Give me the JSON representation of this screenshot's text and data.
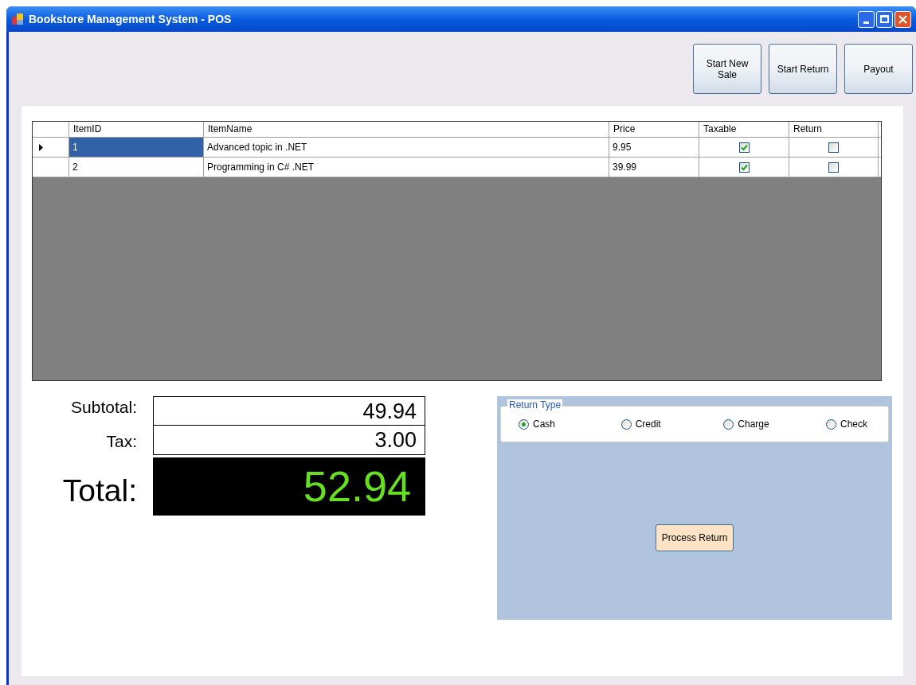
{
  "window": {
    "title": "Bookstore Management System - POS"
  },
  "toolbar_buttons": [
    "Start New\nSale",
    "Start Return",
    "Payout"
  ],
  "table": {
    "columns": [
      "ItemID",
      "ItemName",
      "Price",
      "Taxable",
      "Return"
    ],
    "rows": [
      {
        "selected": true,
        "item_id": "1",
        "item_name": "Advanced topic in .NET",
        "price": "9.95",
        "taxable": true,
        "return": false
      },
      {
        "selected": false,
        "item_id": "2",
        "item_name": "Programming in C# .NET",
        "price": "39.99",
        "taxable": true,
        "return": false
      }
    ]
  },
  "totals": {
    "subtotal_label": "Subtotal:",
    "subtotal": "49.94",
    "tax_label": "Tax:",
    "tax": "3.00",
    "total_label": "Total:",
    "total": "52.94"
  },
  "return_panel": {
    "group_title": "Return Type",
    "options": [
      {
        "label": "Cash",
        "selected": true
      },
      {
        "label": "Credit",
        "selected": false
      },
      {
        "label": "Charge",
        "selected": false
      },
      {
        "label": "Check",
        "selected": false
      }
    ],
    "button": "Process Return"
  }
}
